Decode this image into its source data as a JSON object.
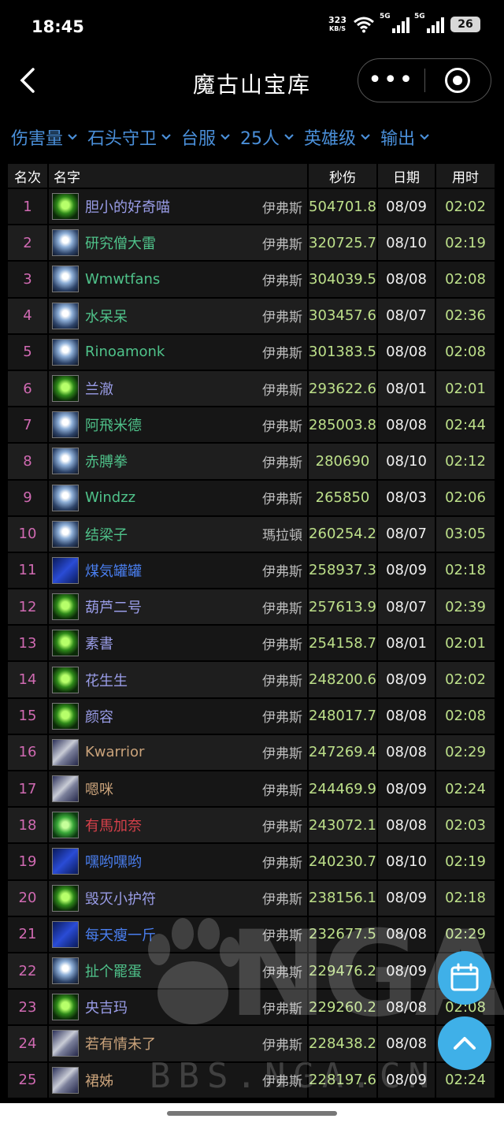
{
  "status_bar": {
    "time": "18:45",
    "net_speed": "323",
    "net_unit": "KB/S",
    "signal1": "5G",
    "signal2": "5G",
    "battery": "26"
  },
  "nav": {
    "title": "魔古山宝库",
    "more": "•••"
  },
  "filters": [
    "伤害量",
    "石头守卫",
    "台服",
    "25人",
    "英雄级",
    "输出"
  ],
  "table": {
    "headers": {
      "rank": "名次",
      "name": "名字",
      "dps": "秒伤",
      "date": "日期",
      "time": "用时"
    },
    "rows": [
      {
        "rank": "1",
        "name": "胆小的好奇喵",
        "server": "伊弗斯",
        "dps": "504701.8",
        "date": "08/09",
        "time": "02:02",
        "icon": "shaman",
        "color": "#9a9de8"
      },
      {
        "rank": "2",
        "name": "研究僧大雷",
        "server": "伊弗斯",
        "dps": "320725.7",
        "date": "08/10",
        "time": "02:19",
        "icon": "monk",
        "color": "#4fc28a"
      },
      {
        "rank": "3",
        "name": "Wmwtfans",
        "server": "伊弗斯",
        "dps": "304039.5",
        "date": "08/08",
        "time": "02:08",
        "icon": "monk",
        "color": "#4fc28a"
      },
      {
        "rank": "4",
        "name": "水呆呆",
        "server": "伊弗斯",
        "dps": "303457.6",
        "date": "08/07",
        "time": "02:36",
        "icon": "monk",
        "color": "#4fc28a"
      },
      {
        "rank": "5",
        "name": "Rinoamonk",
        "server": "伊弗斯",
        "dps": "301383.5",
        "date": "08/08",
        "time": "02:08",
        "icon": "monk",
        "color": "#4fc28a"
      },
      {
        "rank": "6",
        "name": "兰澈",
        "server": "伊弗斯",
        "dps": "293622.6",
        "date": "08/01",
        "time": "02:01",
        "icon": "shaman",
        "color": "#9a9de8"
      },
      {
        "rank": "7",
        "name": "阿飛米德",
        "server": "伊弗斯",
        "dps": "285003.8",
        "date": "08/08",
        "time": "02:44",
        "icon": "monk",
        "color": "#4fc28a"
      },
      {
        "rank": "8",
        "name": "赤膊拳",
        "server": "伊弗斯",
        "dps": "280690",
        "date": "08/10",
        "time": "02:12",
        "icon": "monk",
        "color": "#4fc28a"
      },
      {
        "rank": "9",
        "name": "Windzz",
        "server": "伊弗斯",
        "dps": "265850",
        "date": "08/03",
        "time": "02:06",
        "icon": "monk",
        "color": "#4fc28a"
      },
      {
        "rank": "10",
        "name": "结梁子",
        "server": "瑪拉頓",
        "dps": "260254.2",
        "date": "08/07",
        "time": "03:05",
        "icon": "monk",
        "color": "#4fc28a"
      },
      {
        "rank": "11",
        "name": "煤気罐罐",
        "server": "伊弗斯",
        "dps": "258937.3",
        "date": "08/09",
        "time": "02:18",
        "icon": "lightning",
        "color": "#4a7ff0"
      },
      {
        "rank": "12",
        "name": "葫芦二号",
        "server": "伊弗斯",
        "dps": "257613.9",
        "date": "08/07",
        "time": "02:39",
        "icon": "shaman",
        "color": "#9a9de8"
      },
      {
        "rank": "13",
        "name": "素書",
        "server": "伊弗斯",
        "dps": "254158.7",
        "date": "08/01",
        "time": "02:01",
        "icon": "shaman",
        "color": "#9a9de8"
      },
      {
        "rank": "14",
        "name": "花生生",
        "server": "伊弗斯",
        "dps": "248200.6",
        "date": "08/09",
        "time": "02:02",
        "icon": "shaman",
        "color": "#9a9de8"
      },
      {
        "rank": "15",
        "name": "颜容",
        "server": "伊弗斯",
        "dps": "248017.7",
        "date": "08/08",
        "time": "02:08",
        "icon": "shaman",
        "color": "#9a9de8"
      },
      {
        "rank": "16",
        "name": "Kwarrior",
        "server": "伊弗斯",
        "dps": "247269.4",
        "date": "08/08",
        "time": "02:29",
        "icon": "warrior",
        "color": "#c9a27a"
      },
      {
        "rank": "17",
        "name": "嗯咪",
        "server": "伊弗斯",
        "dps": "244469.9",
        "date": "08/09",
        "time": "02:24",
        "icon": "warrior",
        "color": "#c9a27a"
      },
      {
        "rank": "18",
        "name": "有馬加奈",
        "server": "伊弗斯",
        "dps": "243072.1",
        "date": "08/08",
        "time": "02:03",
        "icon": "green",
        "color": "#d6404a"
      },
      {
        "rank": "19",
        "name": "嘿哟嘿哟",
        "server": "伊弗斯",
        "dps": "240230.7",
        "date": "08/10",
        "time": "02:19",
        "icon": "lightning",
        "color": "#4a7ff0"
      },
      {
        "rank": "20",
        "name": "毁灭小护符",
        "server": "伊弗斯",
        "dps": "238156.1",
        "date": "08/09",
        "time": "02:18",
        "icon": "shaman",
        "color": "#9a9de8"
      },
      {
        "rank": "21",
        "name": "每天瘦一斤",
        "server": "伊弗斯",
        "dps": "232677.5",
        "date": "08/08",
        "time": "02:29",
        "icon": "lightning",
        "color": "#4a7ff0"
      },
      {
        "rank": "22",
        "name": "扯个罷蛋",
        "server": "伊弗斯",
        "dps": "229476.2",
        "date": "08/09",
        "time": "",
        "icon": "monk",
        "color": "#4fc28a"
      },
      {
        "rank": "23",
        "name": "央吉玛",
        "server": "伊弗斯",
        "dps": "229260.2",
        "date": "08/08",
        "time": "02:08",
        "icon": "shaman",
        "color": "#9a9de8"
      },
      {
        "rank": "24",
        "name": "若有情未了",
        "server": "伊弗斯",
        "dps": "228438.2",
        "date": "08/08",
        "time": "",
        "icon": "warrior",
        "color": "#c9a27a"
      },
      {
        "rank": "25",
        "name": "裙姊",
        "server": "伊弗斯",
        "dps": "228197.6",
        "date": "08/09",
        "time": "02:24",
        "icon": "warrior",
        "color": "#c9a27a"
      }
    ]
  },
  "watermark": {
    "brand": "NGA",
    "site": "BBS.NGA.CN"
  },
  "colors": {
    "filter_accent": "#4a8fd9",
    "fab": "#3fb0e8",
    "rank": "#d06ab2",
    "dps": "#bde08a"
  }
}
